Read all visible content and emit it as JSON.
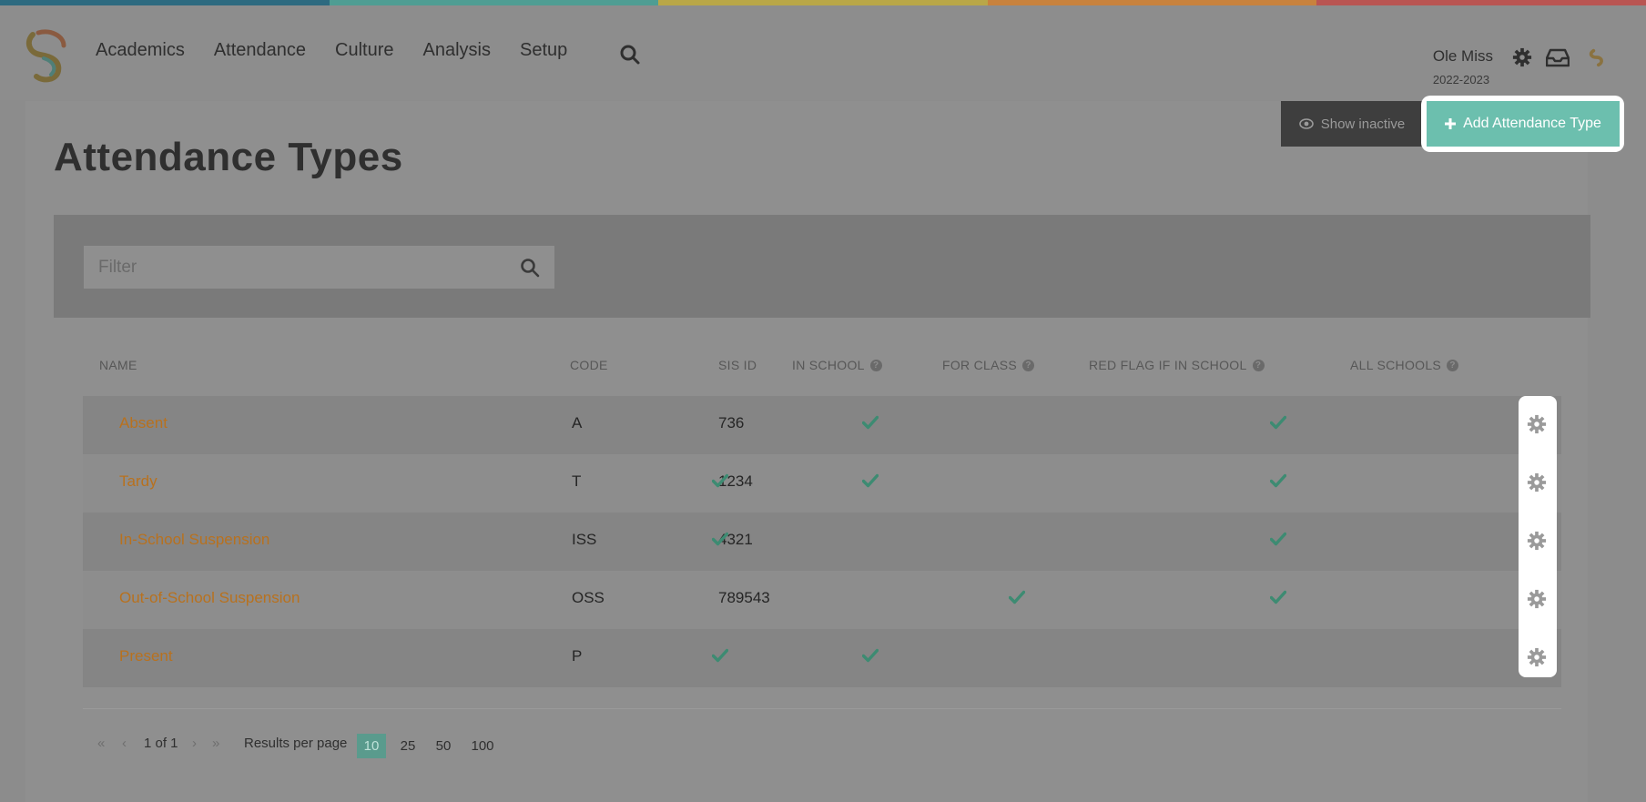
{
  "colors": {
    "stripe": [
      "#2d6a80",
      "#4f9d93",
      "#b9a748",
      "#c8823d",
      "#b95552"
    ],
    "accent": "#6cbfae",
    "link": "#b8711e",
    "check": "#3d8b72"
  },
  "header": {
    "nav": [
      "Academics",
      "Attendance",
      "Culture",
      "Analysis",
      "Setup"
    ],
    "school_name": "Ole Miss",
    "school_year": "2022-2023",
    "icons": [
      "search-icon",
      "gear-icon",
      "inbox-icon",
      "brand-icon"
    ]
  },
  "page": {
    "title": "Attendance Types",
    "show_inactive_label": "Show inactive",
    "add_label": "Add Attendance Type"
  },
  "filter": {
    "placeholder": "Filter"
  },
  "table": {
    "columns": [
      "NAME",
      "CODE",
      "SIS ID",
      "IN SCHOOL",
      "FOR CLASS",
      "RED FLAG IF IN SCHOOL",
      "ALL SCHOOLS"
    ],
    "rows": [
      {
        "name": "Absent",
        "code": "A",
        "sis_id": "736",
        "in_school": false,
        "for_class": true,
        "red_flag": false,
        "all_schools": true
      },
      {
        "name": "Tardy",
        "code": "T",
        "sis_id": "1234",
        "in_school": true,
        "for_class": true,
        "red_flag": false,
        "all_schools": true
      },
      {
        "name": "In-School Suspension",
        "code": "ISS",
        "sis_id": "4321",
        "in_school": true,
        "for_class": false,
        "red_flag": false,
        "all_schools": true
      },
      {
        "name": "Out-of-School Suspension",
        "code": "OSS",
        "sis_id": "789543",
        "in_school": false,
        "for_class": false,
        "red_flag": true,
        "all_schools": true
      },
      {
        "name": "Present",
        "code": "P",
        "sis_id": "",
        "in_school": true,
        "for_class": true,
        "red_flag": false,
        "all_schools": false
      }
    ]
  },
  "pagination": {
    "page_info": "1 of 1",
    "results_label": "Results per page",
    "options": [
      "10",
      "25",
      "50",
      "100"
    ],
    "selected": "10"
  }
}
